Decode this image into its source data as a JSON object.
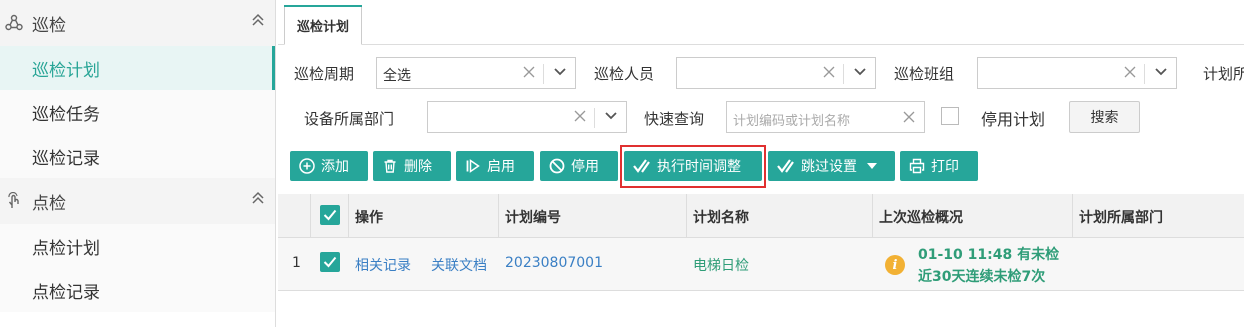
{
  "sidebar": {
    "groups": [
      {
        "label": "巡检",
        "icon": "patrol-icon",
        "items": [
          {
            "label": "巡检计划",
            "active": true
          },
          {
            "label": "巡检任务",
            "active": false
          },
          {
            "label": "巡检记录",
            "active": false
          }
        ]
      },
      {
        "label": "点检",
        "icon": "touch-icon",
        "items": [
          {
            "label": "点检计划",
            "active": false
          },
          {
            "label": "点检记录",
            "active": false
          }
        ]
      }
    ]
  },
  "tab": {
    "label": "巡检计划"
  },
  "filters": {
    "cycle_label": "巡检周期",
    "cycle_value": "全选",
    "person_label": "巡检人员",
    "person_value": "",
    "team_label": "巡检班组",
    "team_value": "",
    "plan_dept_label": "计划所",
    "device_dept_label": "设备所属部门",
    "device_dept_value": "",
    "quick_label": "快速查询",
    "quick_placeholder": "计划编码或计划名称",
    "disabled_label": "停用计划",
    "search_label": "搜索"
  },
  "toolbar": {
    "add": "添加",
    "delete": "删除",
    "enable": "启用",
    "disable": "停用",
    "exec_time": "执行时间调整",
    "skip": "跳过设置",
    "print": "打印"
  },
  "table": {
    "headers": {
      "action": "操作",
      "code": "计划编号",
      "name": "计划名称",
      "last": "上次巡检概况",
      "dept": "计划所属部门"
    },
    "rows": [
      {
        "index": "1",
        "link1": "相关记录",
        "link2": "关联文档",
        "code": "20230807001",
        "name": "电梯日检",
        "last_line1": "01-10 11:48 有未检",
        "last_line2": "近30天连续未检7次",
        "dept": ""
      }
    ]
  },
  "colors": {
    "accent": "#26a69a",
    "highlight": "#e03030",
    "warning": "#f2b134"
  }
}
